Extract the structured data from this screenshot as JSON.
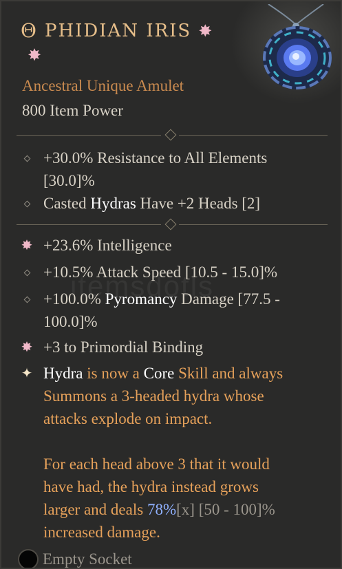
{
  "item": {
    "title_symbol": "Θ",
    "name": "PHIDIAN IRIS",
    "type": "Ancestral Unique Amulet",
    "item_power": "800 Item Power"
  },
  "implicits": [
    {
      "line1": "+30.0% Resistance to All Elements",
      "line2": "[30.0]%"
    },
    {
      "pre": "Casted ",
      "hl": "Hydras",
      "post": " Have +2 Heads [2]"
    }
  ],
  "affixes": {
    "intelligence": "+23.6% Intelligence",
    "attack_speed": "+10.5% Attack Speed [10.5 - 15.0]%",
    "pyro_pre": "+100.0% ",
    "pyro_hl": "Pyromancy",
    "pyro_post": " Damage [77.5 -",
    "pyro_line2": "100.0]%",
    "binding": "+3 to Primordial Binding"
  },
  "unique_power": {
    "l1_a": "Hydra",
    "l1_b": " is now a ",
    "l1_c": "Core",
    "l1_d": " Skill and always",
    "l2": "Summons a 3-headed hydra whose",
    "l3": "attacks explode on impact.",
    "l4": "For each head above 3 that it would",
    "l5": "have had, the hydra instead grows",
    "l6_a": "larger and deals ",
    "l6_b": "78%",
    "l6_c": "[x]",
    "l6_d": " [50 - 100]%",
    "l7": "increased damage."
  },
  "socket": {
    "label": "Empty Socket"
  },
  "watermark": "itemsdotls",
  "colors": {
    "background": "#2a2a29",
    "title": "#e6be8a",
    "unique_text": "#e6a15a",
    "highlight": "#ffffff",
    "roll_value": "#8fb0ff"
  }
}
